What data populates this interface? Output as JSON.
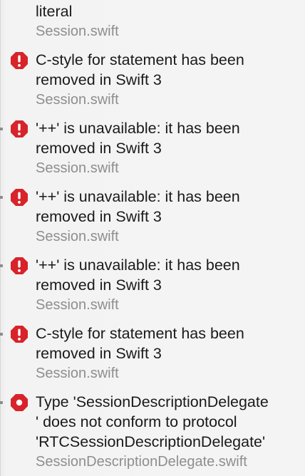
{
  "issues": [
    {
      "title": "literal",
      "file": "Session.swift",
      "icon": ""
    },
    {
      "title": "C-style for statement has been\nremoved in Swift 3",
      "file": "Session.swift",
      "icon": "error-exclamation-icon"
    },
    {
      "title": "'++' is unavailable: it has been\nremoved in Swift 3",
      "file": "Session.swift",
      "icon": "error-exclamation-icon"
    },
    {
      "title": "'++' is unavailable: it has been\nremoved in Swift 3",
      "file": "Session.swift",
      "icon": "error-exclamation-icon"
    },
    {
      "title": "'++' is unavailable: it has been\nremoved in Swift 3",
      "file": "Session.swift",
      "icon": "error-exclamation-icon"
    },
    {
      "title": "C-style for statement has been\nremoved in Swift 3",
      "file": "Session.swift",
      "icon": "error-exclamation-icon"
    },
    {
      "title": "Type 'SessionDescriptionDelegate\n' does not conform to protocol\n'RTCSessionDescriptionDelegate'",
      "file": "SessionDescriptionDelegate.swift",
      "icon": "error-octagon-icon"
    }
  ],
  "colors": {
    "error_red": "#d8232a",
    "title_text": "#1a1a1a",
    "file_text": "#8e8e8e"
  }
}
